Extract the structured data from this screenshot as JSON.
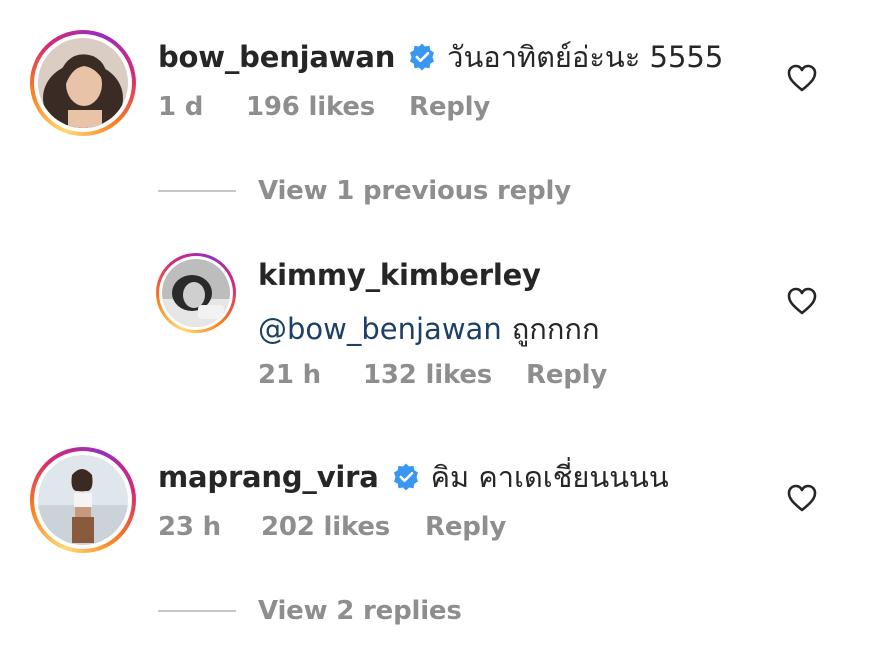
{
  "comments": [
    {
      "username": "bow_benjawan",
      "verified": true,
      "text": "วันอาทิตย์อ่ะนะ 5555",
      "time": "1 d",
      "likes": "196 likes",
      "reply_label": "Reply"
    },
    {
      "username": "kimmy_kimberley",
      "verified": false,
      "mention": "@bow_benjawan",
      "text": "ถูกกกก",
      "time": "21 h",
      "likes": "132 likes",
      "reply_label": "Reply"
    },
    {
      "username": "maprang_vira",
      "verified": true,
      "text": "คิม คาเดเชี่ยนนนน",
      "time": "23 h",
      "likes": "202 likes",
      "reply_label": "Reply"
    }
  ],
  "view_previous_reply": "View 1 previous reply",
  "view_replies": "View 2 replies",
  "colors": {
    "text": "#262626",
    "secondary": "#8e8e8e",
    "mention": "#1e3f66",
    "verified": "#3897f0"
  },
  "icons": {
    "like": "heart-outline-icon",
    "verified": "verified-badge-icon"
  }
}
